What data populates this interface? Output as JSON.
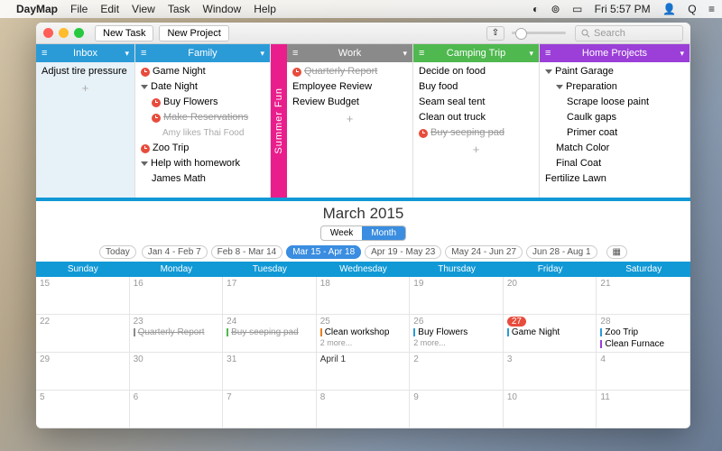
{
  "menubar": {
    "app": "DayMap",
    "items": [
      "File",
      "Edit",
      "View",
      "Task",
      "Window",
      "Help"
    ],
    "clock": "Fri 5:57 PM"
  },
  "toolbar": {
    "new_task": "New Task",
    "new_project": "New Project",
    "search_placeholder": "Search"
  },
  "columns": [
    {
      "title": "Inbox",
      "color": "#2b9bd8",
      "shaded": true,
      "items": [
        {
          "text": "Adjust tire pressure",
          "depth": 0
        }
      ],
      "plus": true
    },
    {
      "title": "Family",
      "color": "#2b9bd8",
      "items": [
        {
          "text": "Game Night",
          "depth": 0,
          "clock": true
        },
        {
          "text": "Date Night",
          "depth": 0,
          "arrow": "down"
        },
        {
          "text": "Buy Flowers",
          "depth": 1,
          "clock": true
        },
        {
          "text": "Make Reservations",
          "depth": 1,
          "clock": true,
          "strike": true
        },
        {
          "text": "Amy likes Thai Food",
          "depth": 2,
          "note": true
        },
        {
          "text": "Zoo Trip",
          "depth": 0,
          "clock": true
        },
        {
          "text": "Help with homework",
          "depth": 0,
          "arrow": "down"
        },
        {
          "text": "James Math",
          "depth": 1
        }
      ]
    },
    {
      "title": "Work",
      "color": "#8a8a8a",
      "items": [
        {
          "text": "Quarterly Report",
          "depth": 0,
          "clock": true,
          "strike": true
        },
        {
          "text": "Employee Review",
          "depth": 0
        },
        {
          "text": "Review Budget",
          "depth": 0
        }
      ],
      "plus": true
    },
    {
      "title": "Camping Trip",
      "color": "#4fb84f",
      "items": [
        {
          "text": "Decide on food",
          "depth": 0
        },
        {
          "text": "Buy food",
          "depth": 0
        },
        {
          "text": "Seam seal tent",
          "depth": 0
        },
        {
          "text": "Clean out truck",
          "depth": 0
        },
        {
          "text": "Buy seeping pad",
          "depth": 0,
          "clock": true,
          "strike": true
        }
      ],
      "plus": true
    },
    {
      "title": "Home Projects",
      "color": "#9b3fd8",
      "items": [
        {
          "text": "Paint Garage",
          "depth": 0,
          "arrow": "down"
        },
        {
          "text": "Preparation",
          "depth": 1,
          "arrow": "down"
        },
        {
          "text": "Scrape loose paint",
          "depth": 2
        },
        {
          "text": "Caulk gaps",
          "depth": 2
        },
        {
          "text": "Primer coat",
          "depth": 2
        },
        {
          "text": "Match Color",
          "depth": 1
        },
        {
          "text": "Final Coat",
          "depth": 1
        },
        {
          "text": "Fertilize Lawn",
          "depth": 0
        }
      ]
    }
  ],
  "spine_label": "Summer Fun",
  "calendar": {
    "title": "March 2015",
    "views": {
      "week": "Week",
      "month": "Month"
    },
    "today": "Today",
    "ranges": [
      "Jan 4 - Feb 7",
      "Feb 8 - Mar 14",
      "Mar 15 - Apr 18",
      "Apr 19 - May 23",
      "May 24 - Jun 27",
      "Jun 28 - Aug 1"
    ],
    "active_range": 2,
    "days": [
      "Sunday",
      "Monday",
      "Tuesday",
      "Wednesday",
      "Thursday",
      "Friday",
      "Saturday"
    ],
    "cells": [
      {
        "n": "15"
      },
      {
        "n": "16"
      },
      {
        "n": "17"
      },
      {
        "n": "18"
      },
      {
        "n": "19"
      },
      {
        "n": "20"
      },
      {
        "n": "21"
      },
      {
        "n": "22"
      },
      {
        "n": "23",
        "events": [
          {
            "t": "Quarterly Report",
            "c": "#8a8a8a",
            "s": true
          }
        ]
      },
      {
        "n": "24",
        "events": [
          {
            "t": "Buy seeping pad",
            "c": "#4fb84f",
            "s": true
          }
        ]
      },
      {
        "n": "25",
        "events": [
          {
            "t": "Clean workshop",
            "c": "#e67e22"
          }
        ],
        "more": "2 more..."
      },
      {
        "n": "26",
        "events": [
          {
            "t": "Buy Flowers",
            "c": "#2b9bd8"
          }
        ],
        "more": "2 more..."
      },
      {
        "n": "27",
        "today": true,
        "events": [
          {
            "t": "Game Night",
            "c": "#2b9bd8"
          }
        ]
      },
      {
        "n": "28",
        "events": [
          {
            "t": "Zoo Trip",
            "c": "#2b9bd8"
          },
          {
            "t": "Clean Furnace",
            "c": "#9b3fd8"
          }
        ]
      },
      {
        "n": "29"
      },
      {
        "n": "30"
      },
      {
        "n": "31"
      },
      {
        "n": "April 1",
        "bold": true
      },
      {
        "n": "2"
      },
      {
        "n": "3"
      },
      {
        "n": "4"
      },
      {
        "n": "5"
      },
      {
        "n": "6"
      },
      {
        "n": "7"
      },
      {
        "n": "8"
      },
      {
        "n": "9"
      },
      {
        "n": "10"
      },
      {
        "n": "11"
      }
    ]
  }
}
